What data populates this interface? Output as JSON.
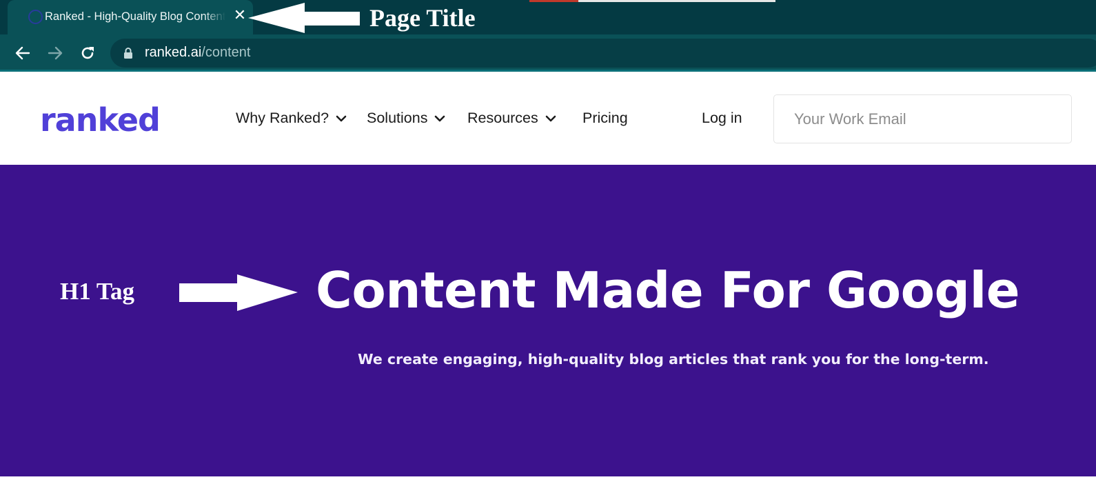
{
  "browser": {
    "tab": {
      "title": "Ranked - High-Quality Blog Content",
      "close_glyph": "✕",
      "favicon": "spinner-icon"
    },
    "url": {
      "host": "ranked.ai",
      "path": "/content"
    },
    "icons": {
      "back": "back-arrow-icon",
      "forward": "forward-arrow-icon",
      "reload": "reload-icon",
      "lock": "lock-icon"
    }
  },
  "annotations": {
    "page_title_label": "Page Title",
    "h1_label": "H1 Tag"
  },
  "site": {
    "logo": "ranked",
    "nav": {
      "why": "Why Ranked?",
      "solutions": "Solutions",
      "resources": "Resources",
      "pricing": "Pricing",
      "login": "Log in"
    },
    "email_placeholder": "Your Work Email"
  },
  "hero": {
    "title": "Content Made For Google",
    "subtitle": "We create engaging, high-quality blog articles that rank you for the long-term."
  },
  "colors": {
    "tabstrip": "#043a43",
    "toolbar": "#0a5157",
    "brand": "#5040d8",
    "hero_bg": "#3c128d"
  }
}
